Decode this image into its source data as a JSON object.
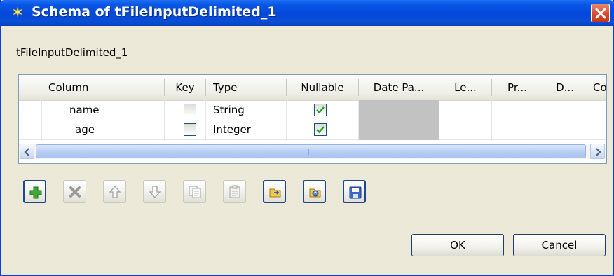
{
  "window": {
    "title": "Schema of tFileInputDelimited_1",
    "component_label": "tFileInputDelimited_1"
  },
  "table": {
    "columns": [
      "Column",
      "Key",
      "Type",
      "Nullable",
      "Date Pa...",
      "Le...",
      "Pr...",
      "D...",
      "Co"
    ],
    "rows": [
      {
        "column": "name",
        "key": false,
        "type": "String",
        "nullable": true
      },
      {
        "column": "age",
        "key": false,
        "type": "Integer",
        "nullable": true
      }
    ]
  },
  "toolbar": {
    "buttons": [
      {
        "icon": "add-icon",
        "enabled": true
      },
      {
        "icon": "remove-icon",
        "enabled": false
      },
      {
        "icon": "move-up-icon",
        "enabled": false
      },
      {
        "icon": "move-down-icon",
        "enabled": false
      },
      {
        "icon": "copy-icon",
        "enabled": false
      },
      {
        "icon": "paste-icon",
        "enabled": false
      },
      {
        "icon": "import-icon",
        "enabled": true
      },
      {
        "icon": "export-icon",
        "enabled": true
      },
      {
        "icon": "save-icon",
        "enabled": true
      }
    ]
  },
  "buttons": {
    "ok": "OK",
    "cancel": "Cancel"
  },
  "colors": {
    "titlebar": "#0448d8",
    "accent_green": "#2b8a1f",
    "dialog_bg": "#ece9d8"
  }
}
